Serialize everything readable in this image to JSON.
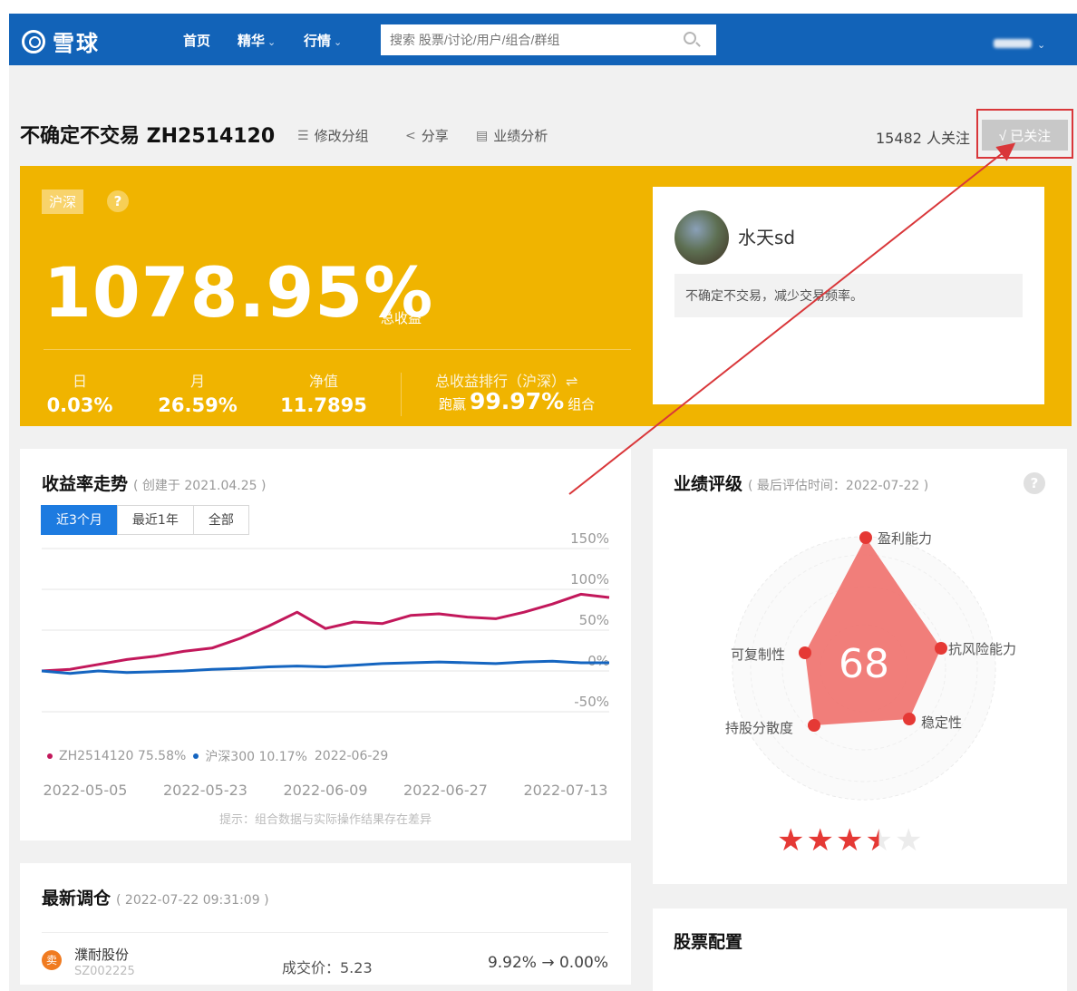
{
  "nav": {
    "logo": "雪球",
    "items": [
      {
        "label": "首页",
        "caret": ""
      },
      {
        "label": "精华",
        "caret": "⌄"
      },
      {
        "label": "行情",
        "caret": "⌄"
      }
    ],
    "search_placeholder": "搜索 股票/讨论/用户/组合/群组",
    "user_caret": "⌄"
  },
  "portfolio": {
    "name": "不确定不交易 ZH2514120",
    "tools": {
      "regroup": "修改分组",
      "share": "分享",
      "analysis": "业绩分析"
    },
    "followers": "15482 人关注",
    "follow_button": "√ 已关注"
  },
  "hero": {
    "market": "沪深",
    "help": "?",
    "total_return": "1078.95%",
    "total_return_label": "总收益",
    "stats": [
      {
        "label": "日",
        "value": "0.03%"
      },
      {
        "label": "月",
        "value": "26.59%"
      },
      {
        "label": "净值",
        "value": "11.7895"
      }
    ],
    "rank_label": "总收益排行（沪深）⇌",
    "rank_prefix": "跑赢",
    "rank_value": "99.97%",
    "rank_suffix": "组合"
  },
  "owner": {
    "name": "水天sd",
    "description": "不确定不交易，减少交易频率。"
  },
  "trend": {
    "title": "收益率走势",
    "subtitle": "( 创建于 2021.04.25 )",
    "tabs": [
      "近3个月",
      "最近1年",
      "全部"
    ],
    "active_tab": 0,
    "legend": {
      "series1": "ZH2514120 75.58%",
      "series2": "沪深300 10.17%",
      "date": "2022-06-29"
    },
    "hint": "提示：组合数据与实际操作结果存在差异"
  },
  "chart_data": {
    "type": "line",
    "x": [
      "2022-05-05",
      "2022-05-09",
      "2022-05-13",
      "2022-05-17",
      "2022-05-21",
      "2022-05-25",
      "2022-05-29",
      "2022-06-02",
      "2022-06-06",
      "2022-06-10",
      "2022-06-14",
      "2022-06-18",
      "2022-06-22",
      "2022-06-26",
      "2022-06-30",
      "2022-07-04",
      "2022-07-08",
      "2022-07-12",
      "2022-07-16",
      "2022-07-20",
      "2022-07-22"
    ],
    "x_ticks": [
      "2022-05-05",
      "2022-05-23",
      "2022-06-09",
      "2022-06-27",
      "2022-07-13"
    ],
    "y_ticks": [
      "150%",
      "100%",
      "50%",
      "0%",
      "-50%"
    ],
    "ylim": [
      -50,
      150
    ],
    "series": [
      {
        "name": "ZH2514120",
        "color": "#c2185b",
        "values": [
          0,
          2,
          8,
          14,
          18,
          24,
          28,
          40,
          55,
          72,
          52,
          60,
          58,
          68,
          70,
          66,
          64,
          72,
          82,
          94,
          90
        ]
      },
      {
        "name": "沪深300",
        "color": "#1565c0",
        "values": [
          0,
          -3,
          0,
          -2,
          -1,
          0,
          2,
          3,
          5,
          6,
          5,
          7,
          9,
          10,
          11,
          10,
          9,
          11,
          12,
          10,
          10
        ]
      }
    ]
  },
  "rating": {
    "title": "业绩评级",
    "subtitle": "( 最后评估时间：2022-07-22 )",
    "help": "?",
    "score": "68",
    "axes": [
      "盈利能力",
      "抗风险能力",
      "稳定性",
      "持股分散度",
      "可复制性"
    ],
    "stars": 3.5
  },
  "trades": {
    "title": "最新调仓",
    "subtitle": "( 2022-07-22 09:31:09 )",
    "items": [
      {
        "icon_label": "卖",
        "name": "濮耐股份",
        "code": "SZ002225",
        "price": "成交价：5.23",
        "change": "9.92% → 0.00%"
      }
    ]
  },
  "allocation": {
    "title": "股票配置"
  },
  "colors": {
    "nav": "#1263b8",
    "hero": "#f0b400",
    "accent": "#1d7be0",
    "annotation": "#d9373a"
  }
}
